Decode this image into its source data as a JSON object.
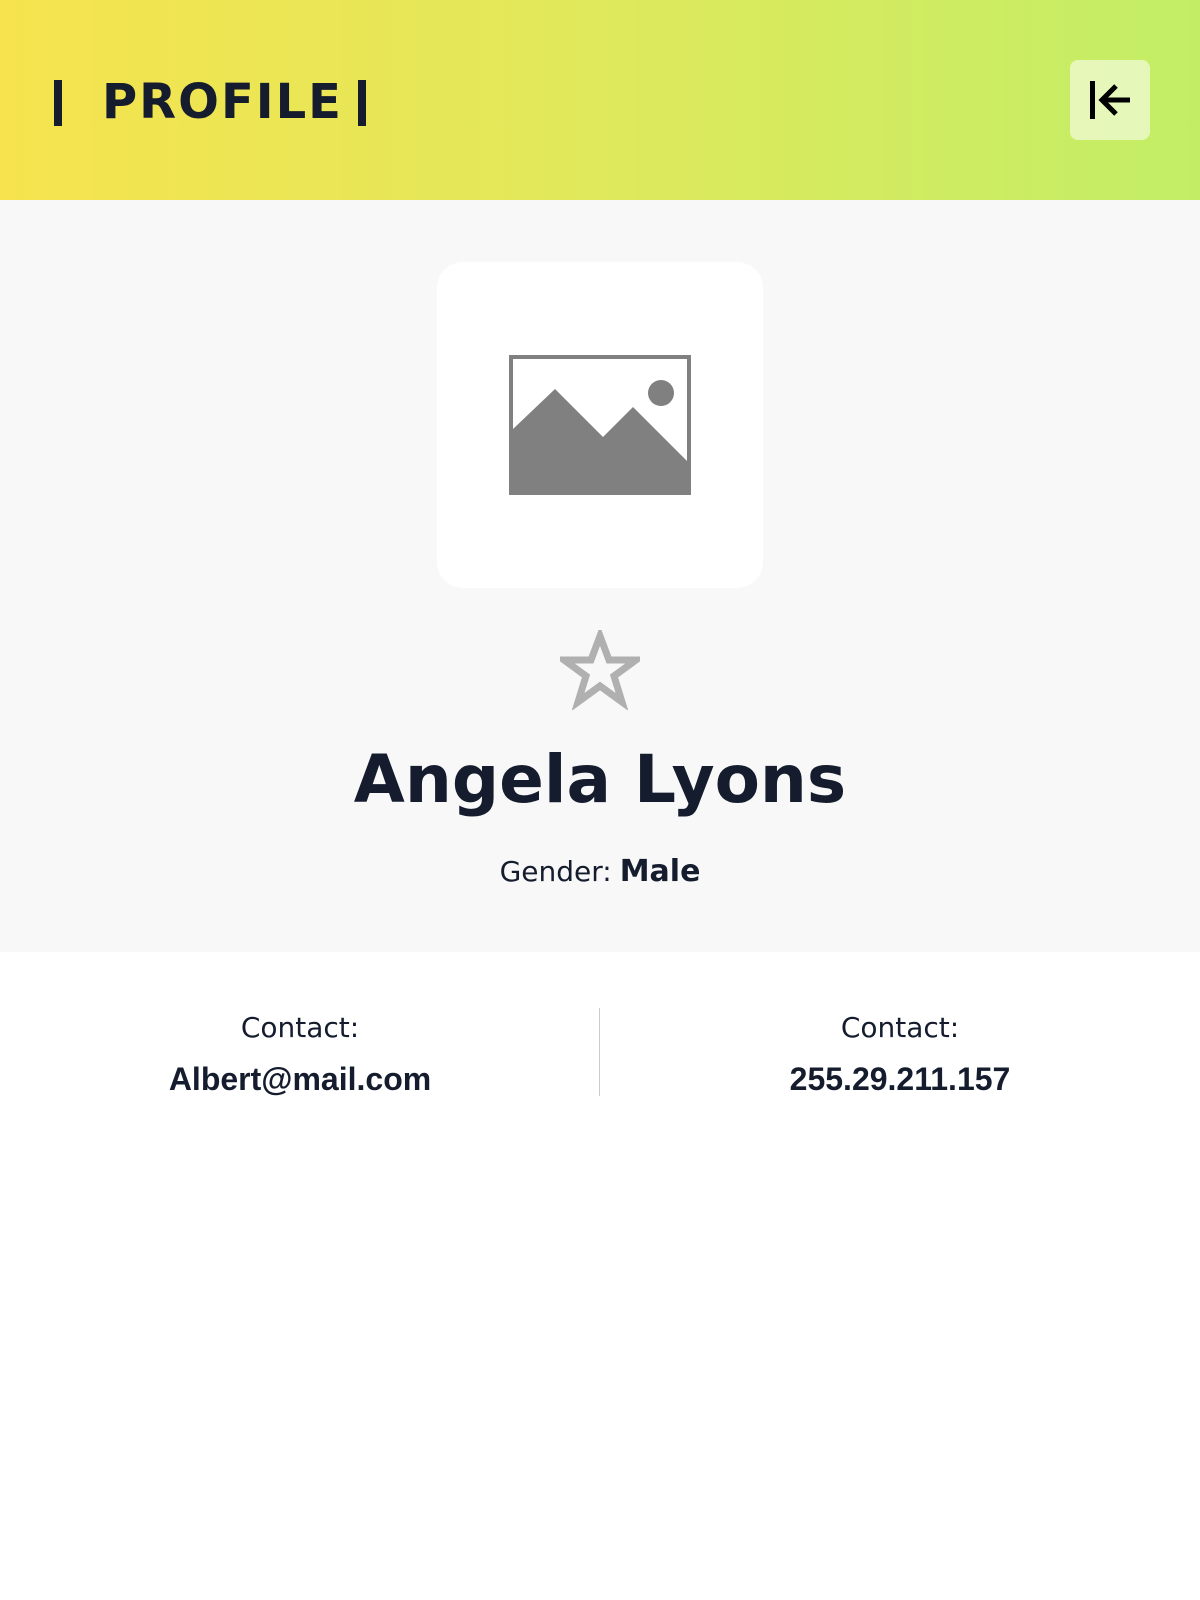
{
  "header": {
    "title": "PROFILE",
    "back_icon": "collapse-left-icon",
    "gradient_start": "#f6e34e",
    "gradient_end": "#c2ee66"
  },
  "profile": {
    "avatar_icon": "image-placeholder-icon",
    "favorite_icon": "star-outline-icon",
    "name": "Angela Lyons",
    "gender_label": "Gender:",
    "gender_value": "Male"
  },
  "contacts": [
    {
      "label": "Contact:",
      "value": "Albert@mail.com"
    },
    {
      "label": "Contact:",
      "value": "255.29.211.157"
    }
  ]
}
